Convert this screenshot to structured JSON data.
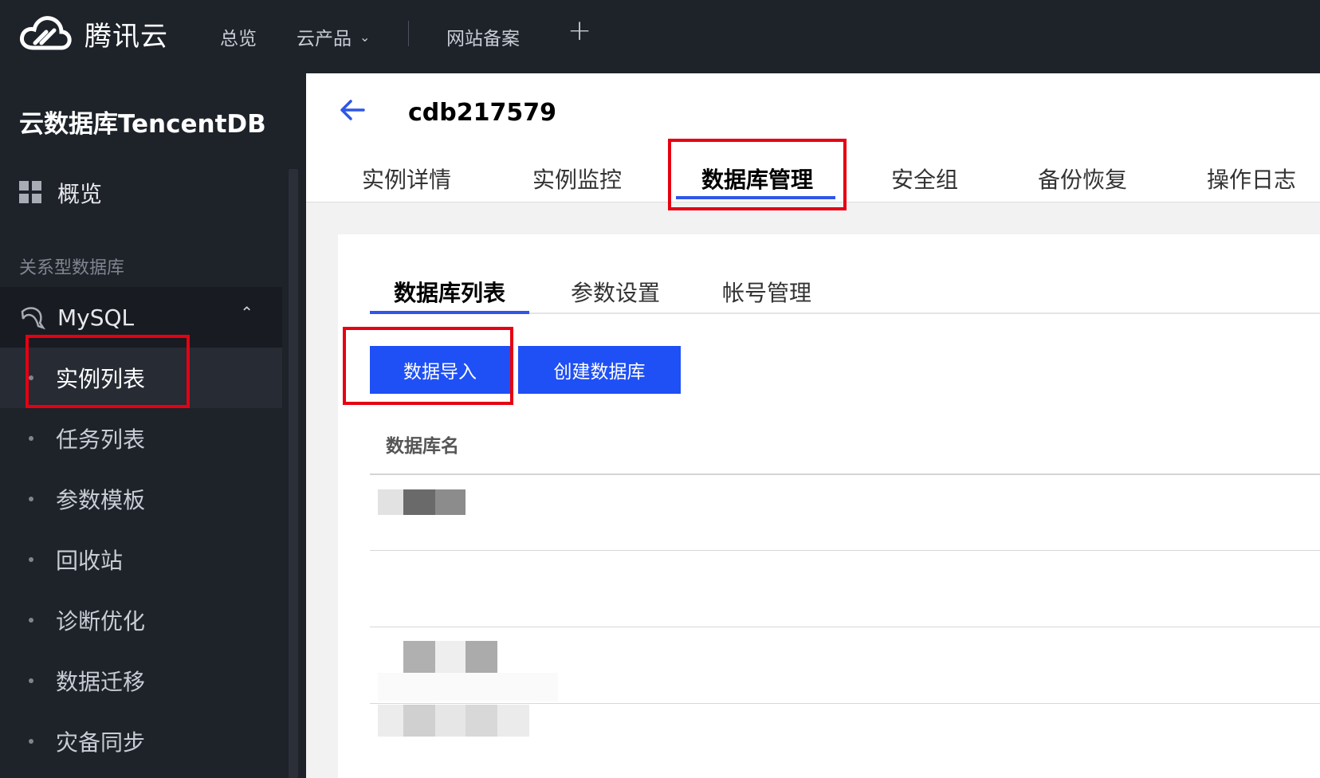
{
  "header": {
    "brand": "腾讯云",
    "nav": [
      {
        "label": "总览"
      },
      {
        "label": "云产品"
      },
      {
        "label": "网站备案"
      }
    ],
    "plus_glyph": "+",
    "dropdown_glyph": "⌄"
  },
  "sidebar": {
    "title": "云数据库TencentDB",
    "overview_label": "概览",
    "section_label": "关系型数据库",
    "group_label": "MySQL",
    "group_caret": "⌃",
    "items": [
      {
        "label": "实例列表",
        "active": true
      },
      {
        "label": "任务列表"
      },
      {
        "label": "参数模板"
      },
      {
        "label": "回收站"
      },
      {
        "label": "诊断优化"
      },
      {
        "label": "数据迁移"
      },
      {
        "label": "灾备同步"
      }
    ]
  },
  "instance": {
    "title": "cdb217579",
    "tabs": [
      {
        "label": "实例详情"
      },
      {
        "label": "实例监控"
      },
      {
        "label": "数据库管理",
        "active": true
      },
      {
        "label": "安全组"
      },
      {
        "label": "备份恢复"
      },
      {
        "label": "操作日志"
      }
    ]
  },
  "db_manage": {
    "subtabs": [
      {
        "label": "数据库列表",
        "active": true
      },
      {
        "label": "参数设置"
      },
      {
        "label": "帐号管理"
      }
    ],
    "import_button": "数据导入",
    "create_button": "创建数据库",
    "table_header": "数据库名"
  },
  "colors": {
    "primary": "#1f50f5",
    "highlight": "#e60012",
    "dark_bg": "#1e2229"
  }
}
